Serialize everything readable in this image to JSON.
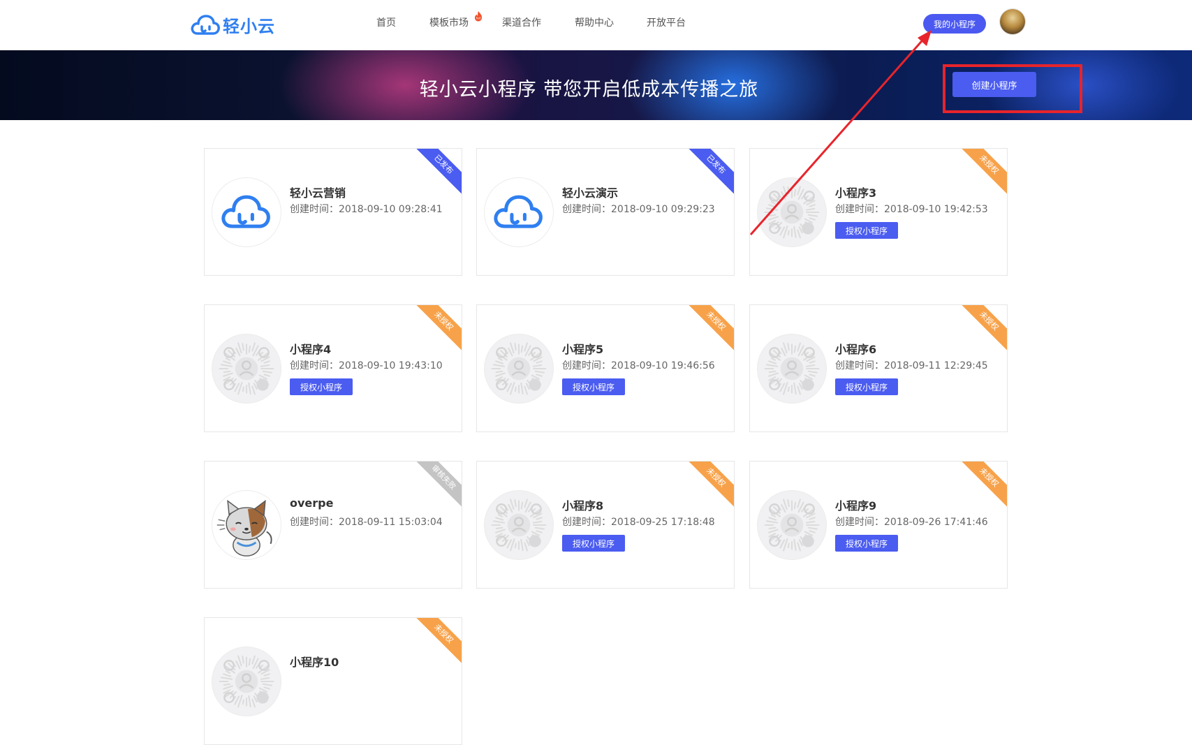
{
  "header": {
    "logo_text": "轻小云",
    "nav": [
      "首页",
      "模板市场",
      "渠道合作",
      "帮助中心",
      "开放平台"
    ],
    "hot_badge": "hot",
    "my_programs_button": "我的小程序"
  },
  "banner": {
    "title": "轻小云小程序 带您开启低成本传播之旅",
    "create_button": "创建小程序"
  },
  "time_label": "创建时间：",
  "auth_button_label": "授权小程序",
  "status_labels": {
    "published": "已发布",
    "unauthorized": "未授权",
    "review_failed": "审核失败"
  },
  "cards": [
    {
      "name": "轻小云营销",
      "time": "2018-09-10 09:28:41",
      "status": "已发布",
      "status_color": "#4b5cf0",
      "thumb": "cloud-logo-icon",
      "show_auth": false
    },
    {
      "name": "轻小云演示",
      "time": "2018-09-10 09:29:23",
      "status": "已发布",
      "status_color": "#4b5cf0",
      "thumb": "cloud-logo-icon",
      "show_auth": false
    },
    {
      "name": "小程序3",
      "time": "2018-09-10 19:42:53",
      "status": "未授权",
      "status_color": "#f7a24a",
      "thumb": "mini-program-code-icon",
      "show_auth": true
    },
    {
      "name": "小程序4",
      "time": "2018-09-10 19:43:10",
      "status": "未授权",
      "status_color": "#f7a24a",
      "thumb": "mini-program-code-icon",
      "show_auth": true
    },
    {
      "name": "小程序5",
      "time": "2018-09-10 19:46:56",
      "status": "未授权",
      "status_color": "#f7a24a",
      "thumb": "mini-program-code-icon",
      "show_auth": true
    },
    {
      "name": "小程序6",
      "time": "2018-09-11 12:29:45",
      "status": "未授权",
      "status_color": "#f7a24a",
      "thumb": "mini-program-code-icon",
      "show_auth": true
    },
    {
      "name": "overpe",
      "time": "2018-09-11 15:03:04",
      "status": "审核失败",
      "status_color": "#c4c4c4",
      "thumb": "cat-avatar-icon",
      "show_auth": false
    },
    {
      "name": "小程序8",
      "time": "2018-09-25 17:18:48",
      "status": "未授权",
      "status_color": "#f7a24a",
      "thumb": "mini-program-code-icon",
      "show_auth": true
    },
    {
      "name": "小程序9",
      "time": "2018-09-26 17:41:46",
      "status": "未授权",
      "status_color": "#f7a24a",
      "thumb": "mini-program-code-icon",
      "show_auth": true
    },
    {
      "name": "小程序10",
      "time": "",
      "status": "未授权",
      "status_color": "#f7a24a",
      "thumb": "mini-program-code-icon",
      "show_auth": false
    }
  ],
  "colors": {
    "accent": "#4b5cf0",
    "brand": "#2f7ff0",
    "annotation": "#e8242b"
  }
}
